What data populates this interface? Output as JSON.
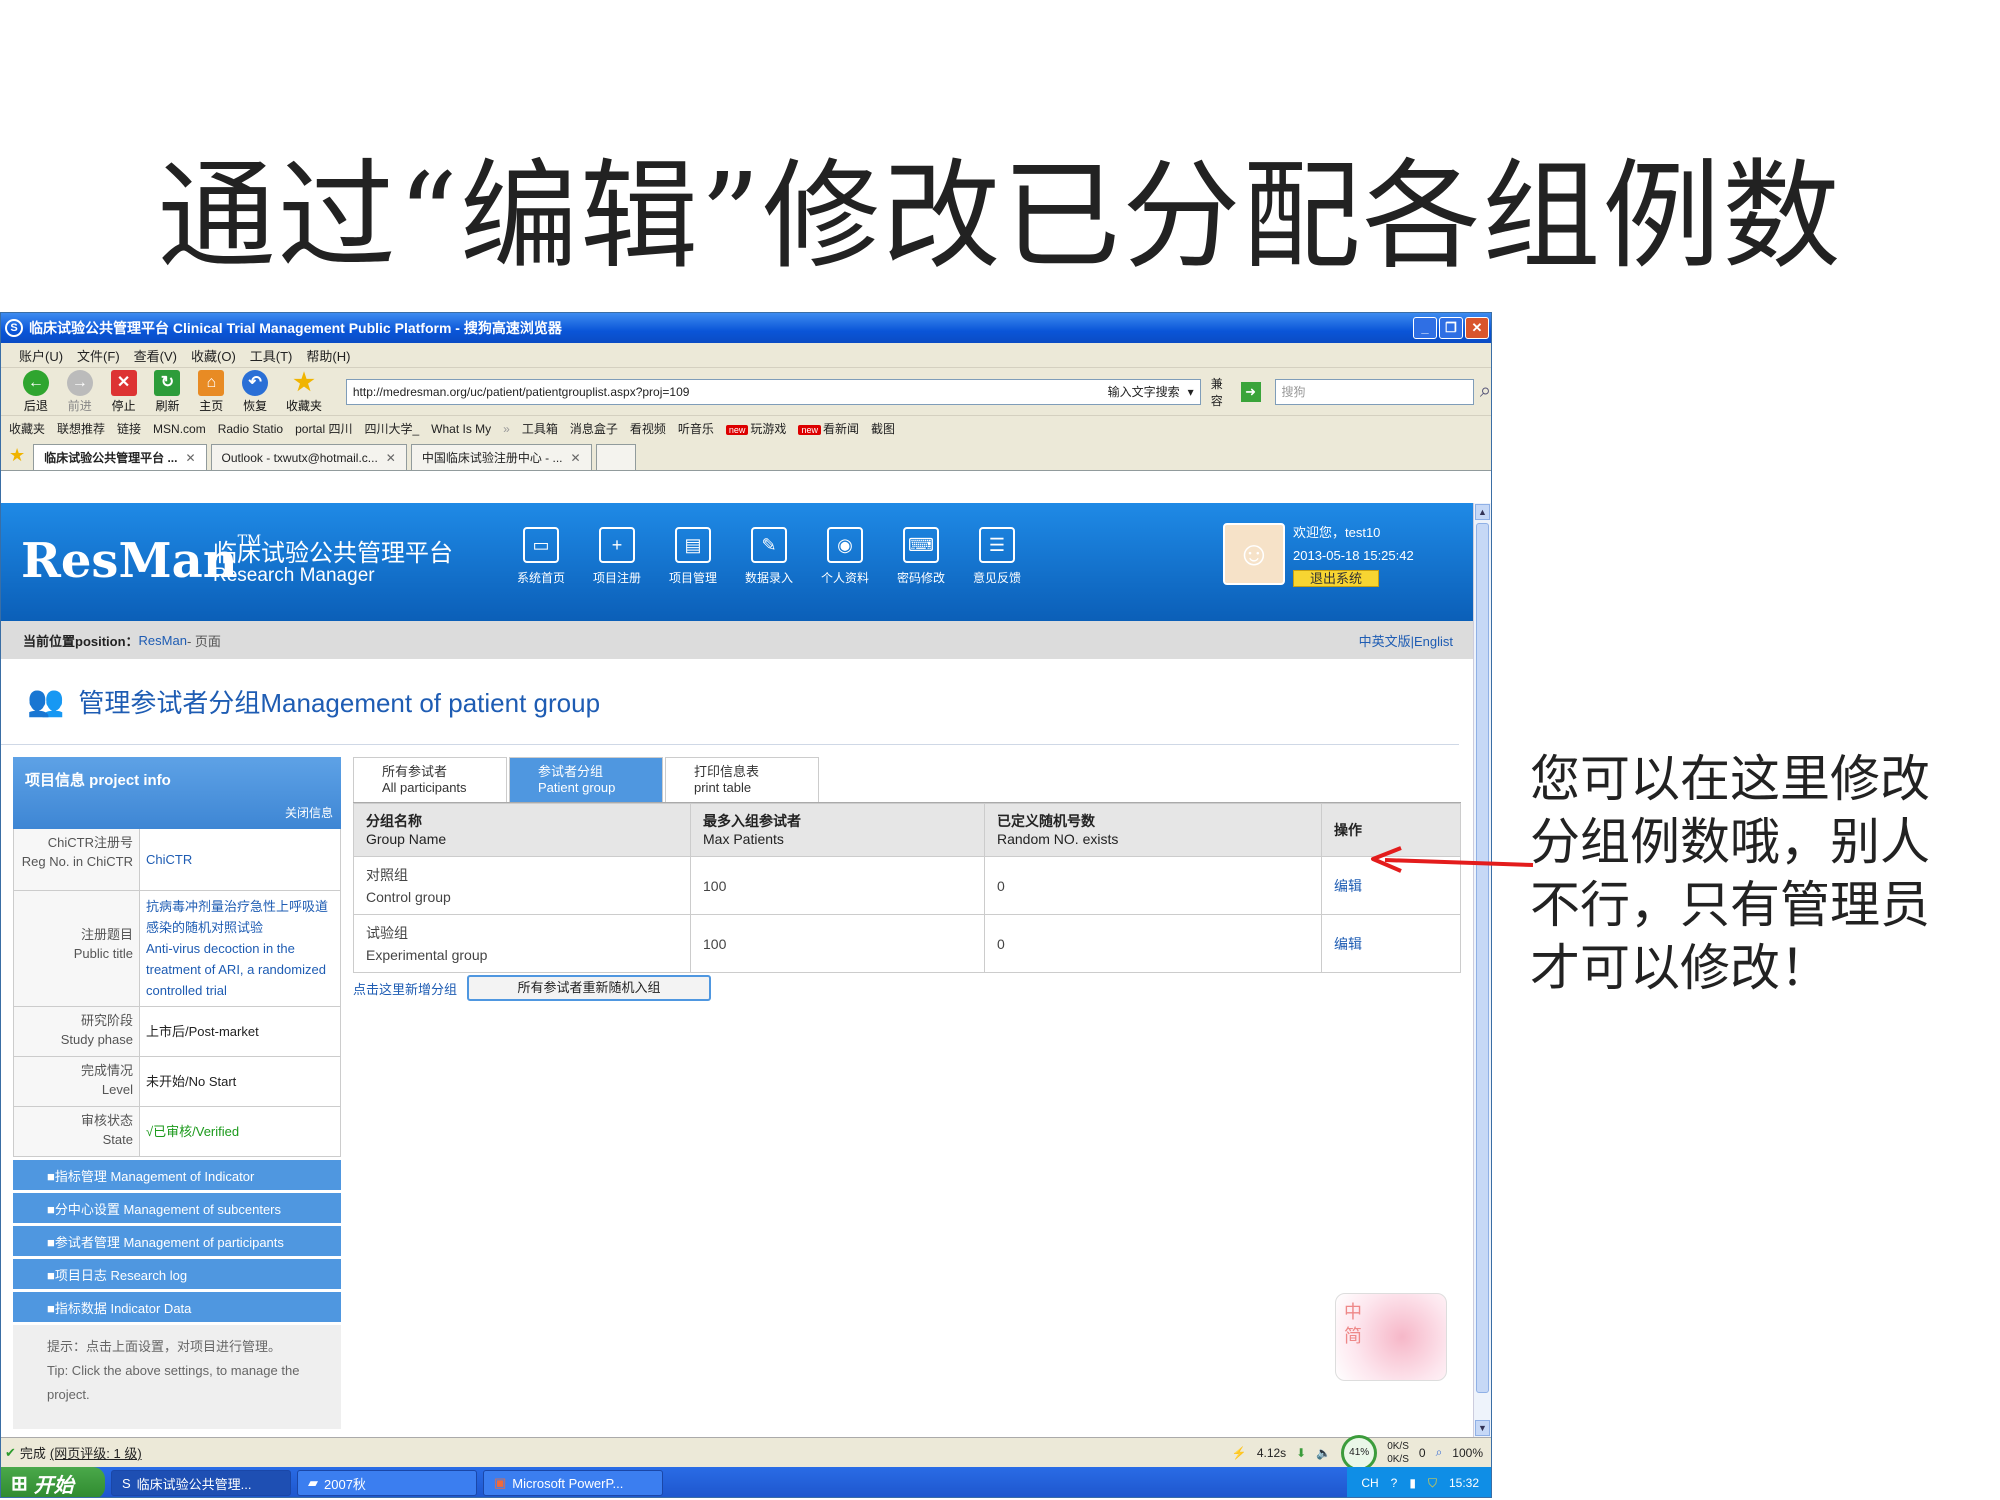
{
  "slide": {
    "title": "通过“编辑”修改已分配各组例数",
    "annotation": "您可以在这里修改分组例数哦，别人不行，只有管理员才可以修改！"
  },
  "window": {
    "title": "临床试验公共管理平台 Clinical Trial Management Public Platform - 搜狗高速浏览器",
    "menu": [
      "账户(U)",
      "文件(F)",
      "查看(V)",
      "收藏(O)",
      "工具(T)",
      "帮助(H)"
    ],
    "toolbar": {
      "back": "后退",
      "forward": "前进",
      "stop": "停止",
      "refresh": "刷新",
      "home": "主页",
      "restore": "恢复",
      "favorites": "收藏夹"
    },
    "address": "http://medresman.org/uc/patient/patientgrouplist.aspx?proj=109",
    "address_hint": "输入文字搜索",
    "compat": "兼容",
    "search_placeholder": "搜狗",
    "favbar": [
      "收藏夹",
      "联想推荐",
      "链接",
      "MSN.com",
      "Radio Statio",
      "portal 四川",
      "四川大学_",
      "What Is My",
      "工具箱",
      "消息盒子",
      "看视频",
      "听音乐",
      "玩游戏",
      "看新闻",
      "截图"
    ],
    "new_badge": "new",
    "tabs": [
      "临床试验公共管理平台 ...",
      "Outlook - txwutx@hotmail.c...",
      "中国临床试验注册中心 - ..."
    ]
  },
  "site": {
    "logo": "ResMan",
    "logo_tm": "TM",
    "logo_cn": "临床试验公共管理平台",
    "logo_en": "Research Manager",
    "nav": [
      "系统首页",
      "项目注册",
      "项目管理",
      "数据录入",
      "个人资料",
      "密码修改",
      "意见反馈"
    ],
    "welcome": "欢迎您，test10",
    "datetime": "2013-05-18 15:25:42",
    "logout": "退出系统",
    "position_label": "当前位置position：",
    "position_path": "ResMan",
    "position_tail": " - 页面",
    "lang": "中英文版|Englist",
    "page_heading": "管理参试者分组Management of patient group"
  },
  "project": {
    "head": "项目信息  project info",
    "close": "关闭信息",
    "rows": [
      {
        "k": "ChiCTR注册号\nReg No. in ChiCTR",
        "v": "ChiCTR"
      },
      {
        "k": "注册题目\nPublic title",
        "v": "抗病毒冲剂量治疗急性上呼吸道感染的随机对照试验\nAnti-virus decoction in the treatment of ARI, a randomized controlled trial"
      },
      {
        "k": "研究阶段\nStudy phase",
        "v": "上市后/Post-market"
      },
      {
        "k": "完成情况\nLevel",
        "v": "未开始/No Start"
      },
      {
        "k": "审核状态\nState",
        "v": "√已审核/Verified"
      }
    ],
    "menu": [
      "■指标管理  Management of Indicator",
      "■分中心设置  Management of subcenters",
      "■参试者管理  Management of participants",
      "■项目日志  Research log",
      "■指标数据  Indicator Data"
    ],
    "tip": "提示：点击上面设置，对项目进行管理。\nTip: Click the above settings, to manage the project."
  },
  "groups": {
    "tabs": [
      {
        "cn": "所有参试者",
        "en": "All participants"
      },
      {
        "cn": "参试者分组",
        "en": "Patient group"
      },
      {
        "cn": "打印信息表",
        "en": "print table"
      }
    ],
    "columns": [
      {
        "cn": "分组名称",
        "en": "Group Name"
      },
      {
        "cn": "最多入组参试者",
        "en": "Max Patients"
      },
      {
        "cn": "已定义随机号数",
        "en": "Random NO. exists"
      },
      {
        "cn": "操作",
        "en": ""
      }
    ],
    "rows": [
      {
        "name_cn": "对照组",
        "name_en": "Control group",
        "max": "100",
        "exists": "0",
        "action": "编辑"
      },
      {
        "name_cn": "试验组",
        "name_en": "Experimental group",
        "max": "100",
        "exists": "0",
        "action": "编辑"
      }
    ],
    "add_group": "点击这里新增分组",
    "reassign": "所有参试者重新随机入组"
  },
  "card": {
    "text": "中\n简"
  },
  "status": {
    "done": "完成",
    "rating": "(网页评级: 1 级)",
    "speed": "4.12s",
    "meter": "41%",
    "up": "0K/S",
    "down": "0K/S",
    "count": "0",
    "zoom": "100%"
  },
  "taskbar": {
    "start": "开始",
    "tasks": [
      "临床试验公共管理...",
      "2007秋",
      "Microsoft PowerP..."
    ],
    "lang": "CH",
    "time": "15:32"
  }
}
